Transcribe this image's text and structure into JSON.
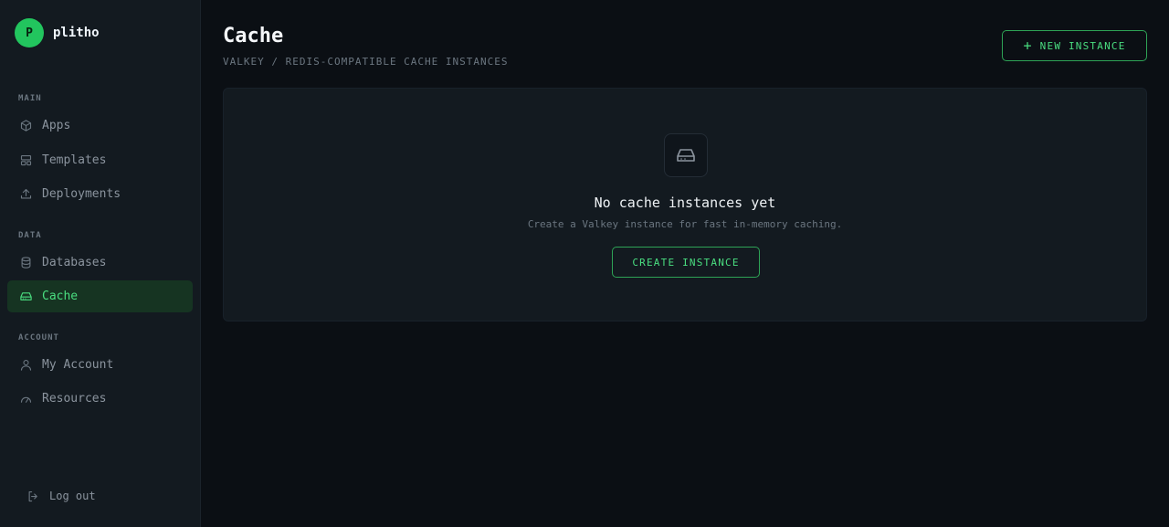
{
  "brand": {
    "initial": "P",
    "name": "plitho"
  },
  "sidebar": {
    "sections": [
      {
        "label": "MAIN",
        "items": [
          {
            "label": "Apps",
            "icon": "cube-icon"
          },
          {
            "label": "Templates",
            "icon": "layout-icon"
          },
          {
            "label": "Deployments",
            "icon": "upload-icon"
          }
        ]
      },
      {
        "label": "DATA",
        "items": [
          {
            "label": "Databases",
            "icon": "database-icon"
          },
          {
            "label": "Cache",
            "icon": "hard-drive-icon",
            "active": true
          }
        ]
      },
      {
        "label": "ACCOUNT",
        "items": [
          {
            "label": "My Account",
            "icon": "user-icon"
          },
          {
            "label": "Resources",
            "icon": "gauge-icon"
          }
        ]
      }
    ],
    "logout_label": "Log out"
  },
  "page": {
    "title": "Cache",
    "subtitle": "VALKEY / REDIS-COMPATIBLE CACHE INSTANCES",
    "new_button_label": "NEW INSTANCE"
  },
  "empty_state": {
    "title": "No cache instances yet",
    "description": "Create a Valkey instance for fast in-memory caching.",
    "button_label": "CREATE INSTANCE"
  },
  "colors": {
    "accent": "#22c55e",
    "accent_text": "#4ade80",
    "active_bg": "#163422",
    "sidebar_bg": "#131a20",
    "main_bg": "#0b0f14"
  }
}
